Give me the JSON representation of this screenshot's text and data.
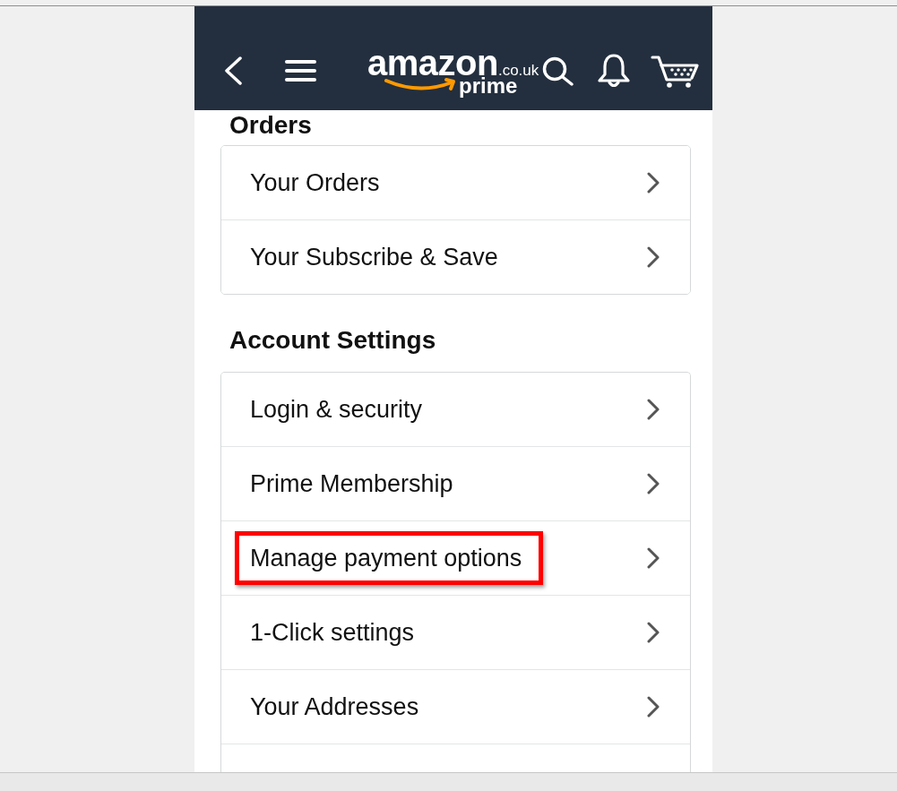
{
  "header": {
    "logo": {
      "wordmark": "amazon",
      "domain": ".co.uk",
      "tier": "prime"
    }
  },
  "sections": [
    {
      "title": "Orders",
      "continues": false,
      "items": [
        {
          "label": "Your Orders",
          "highlighted": false
        },
        {
          "label": "Your Subscribe & Save",
          "highlighted": false
        }
      ]
    },
    {
      "title": "Account Settings",
      "continues": true,
      "items": [
        {
          "label": "Login & security",
          "highlighted": false
        },
        {
          "label": "Prime Membership",
          "highlighted": false
        },
        {
          "label": "Manage payment options",
          "highlighted": true
        },
        {
          "label": "1-Click settings",
          "highlighted": false
        },
        {
          "label": "Your Addresses",
          "highlighted": false
        }
      ]
    }
  ]
}
